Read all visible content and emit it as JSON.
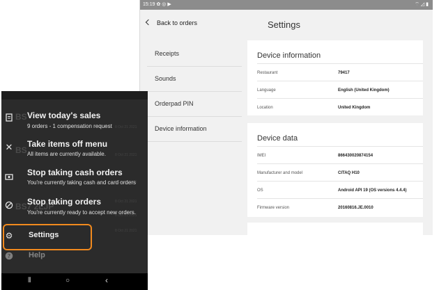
{
  "tablet": {
    "status_time": "15:19 ✿ ◎ ▶",
    "status_right": "⌔ ◿ ▮",
    "back_label": "Back to orders",
    "page_title": "Settings",
    "nav": [
      "Receipts",
      "Sounds",
      "Orderpad PIN",
      "Device information"
    ],
    "device_information": {
      "title": "Device information",
      "rows": [
        {
          "label": "Restaurant",
          "value": "79417"
        },
        {
          "label": "Language",
          "value": "English (United Kingdom)"
        },
        {
          "label": "Location",
          "value": "United Kingdom"
        }
      ]
    },
    "device_data": {
      "title": "Device data",
      "rows": [
        {
          "label": "IMEI",
          "value": "866430020874154"
        },
        {
          "label": "Manufacturer and model",
          "value": "CITAQ H10"
        },
        {
          "label": "OS",
          "value": "Android API 19 (OS versions 4.4.4)"
        },
        {
          "label": "Firmware version",
          "value": "20160816.JE.0010"
        }
      ]
    }
  },
  "phone": {
    "background": {
      "codes": [
        "BS",
        "BS",
        "BS7 2LJP"
      ],
      "dates": [
        "8 Oct 21 2021",
        "8 Oct 21 2021",
        "8 Oct 21 2021",
        "8 Oct 21 2021",
        "8 Oct 21 2021",
        "8 Oct 21 2021"
      ]
    },
    "menu": [
      {
        "title": "View today's sales",
        "subtitle": "9 orders - 1 compensation request",
        "icon": "receipt-icon"
      },
      {
        "title": "Take items off menu",
        "subtitle": "All items are currently available.",
        "icon": "cross-icon"
      },
      {
        "title": "Stop taking cash orders",
        "subtitle": "You're currently taking cash and card orders",
        "icon": "cash-icon"
      },
      {
        "title": "Stop taking orders",
        "subtitle": "You're currently ready to accept new orders.",
        "icon": "block-icon"
      },
      {
        "title": "Settings",
        "subtitle": "",
        "icon": "gear-icon"
      },
      {
        "title": "Help",
        "subtitle": "",
        "icon": "help-icon"
      }
    ],
    "nav": {
      "recents": "⦀",
      "home": "○",
      "back": "‹"
    },
    "highlight_color": "#f28a1e"
  }
}
